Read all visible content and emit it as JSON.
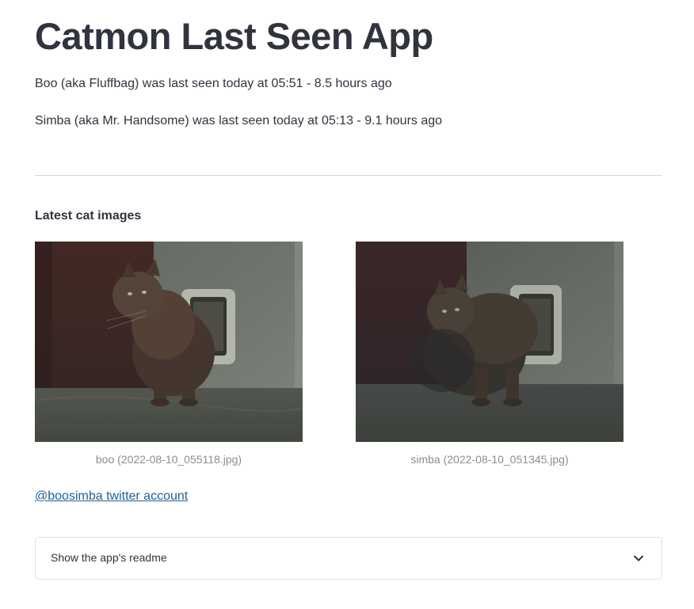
{
  "app": {
    "title": "Catmon Last Seen App"
  },
  "status": {
    "boo": "Boo (aka Fluffbag) was last seen today at 05:51 - 8.5 hours ago",
    "simba": "Simba (aka Mr. Handsome) was last seen today at 05:13 - 9.1 hours ago"
  },
  "latest_images": {
    "heading": "Latest cat images",
    "items": [
      {
        "caption": "boo (2022-08-10_055118.jpg)"
      },
      {
        "caption": "simba (2022-08-10_051345.jpg)"
      }
    ]
  },
  "twitter_link": {
    "label": "@boosimba twitter account"
  },
  "readme_expander": {
    "label": "Show the app's readme",
    "icon": "chevron-down-icon"
  },
  "colors": {
    "text": "#31333f",
    "link": "#1f5f96",
    "caption": "#8b8d93",
    "divider": "#d6d6d9",
    "border": "#dfe0e3"
  }
}
